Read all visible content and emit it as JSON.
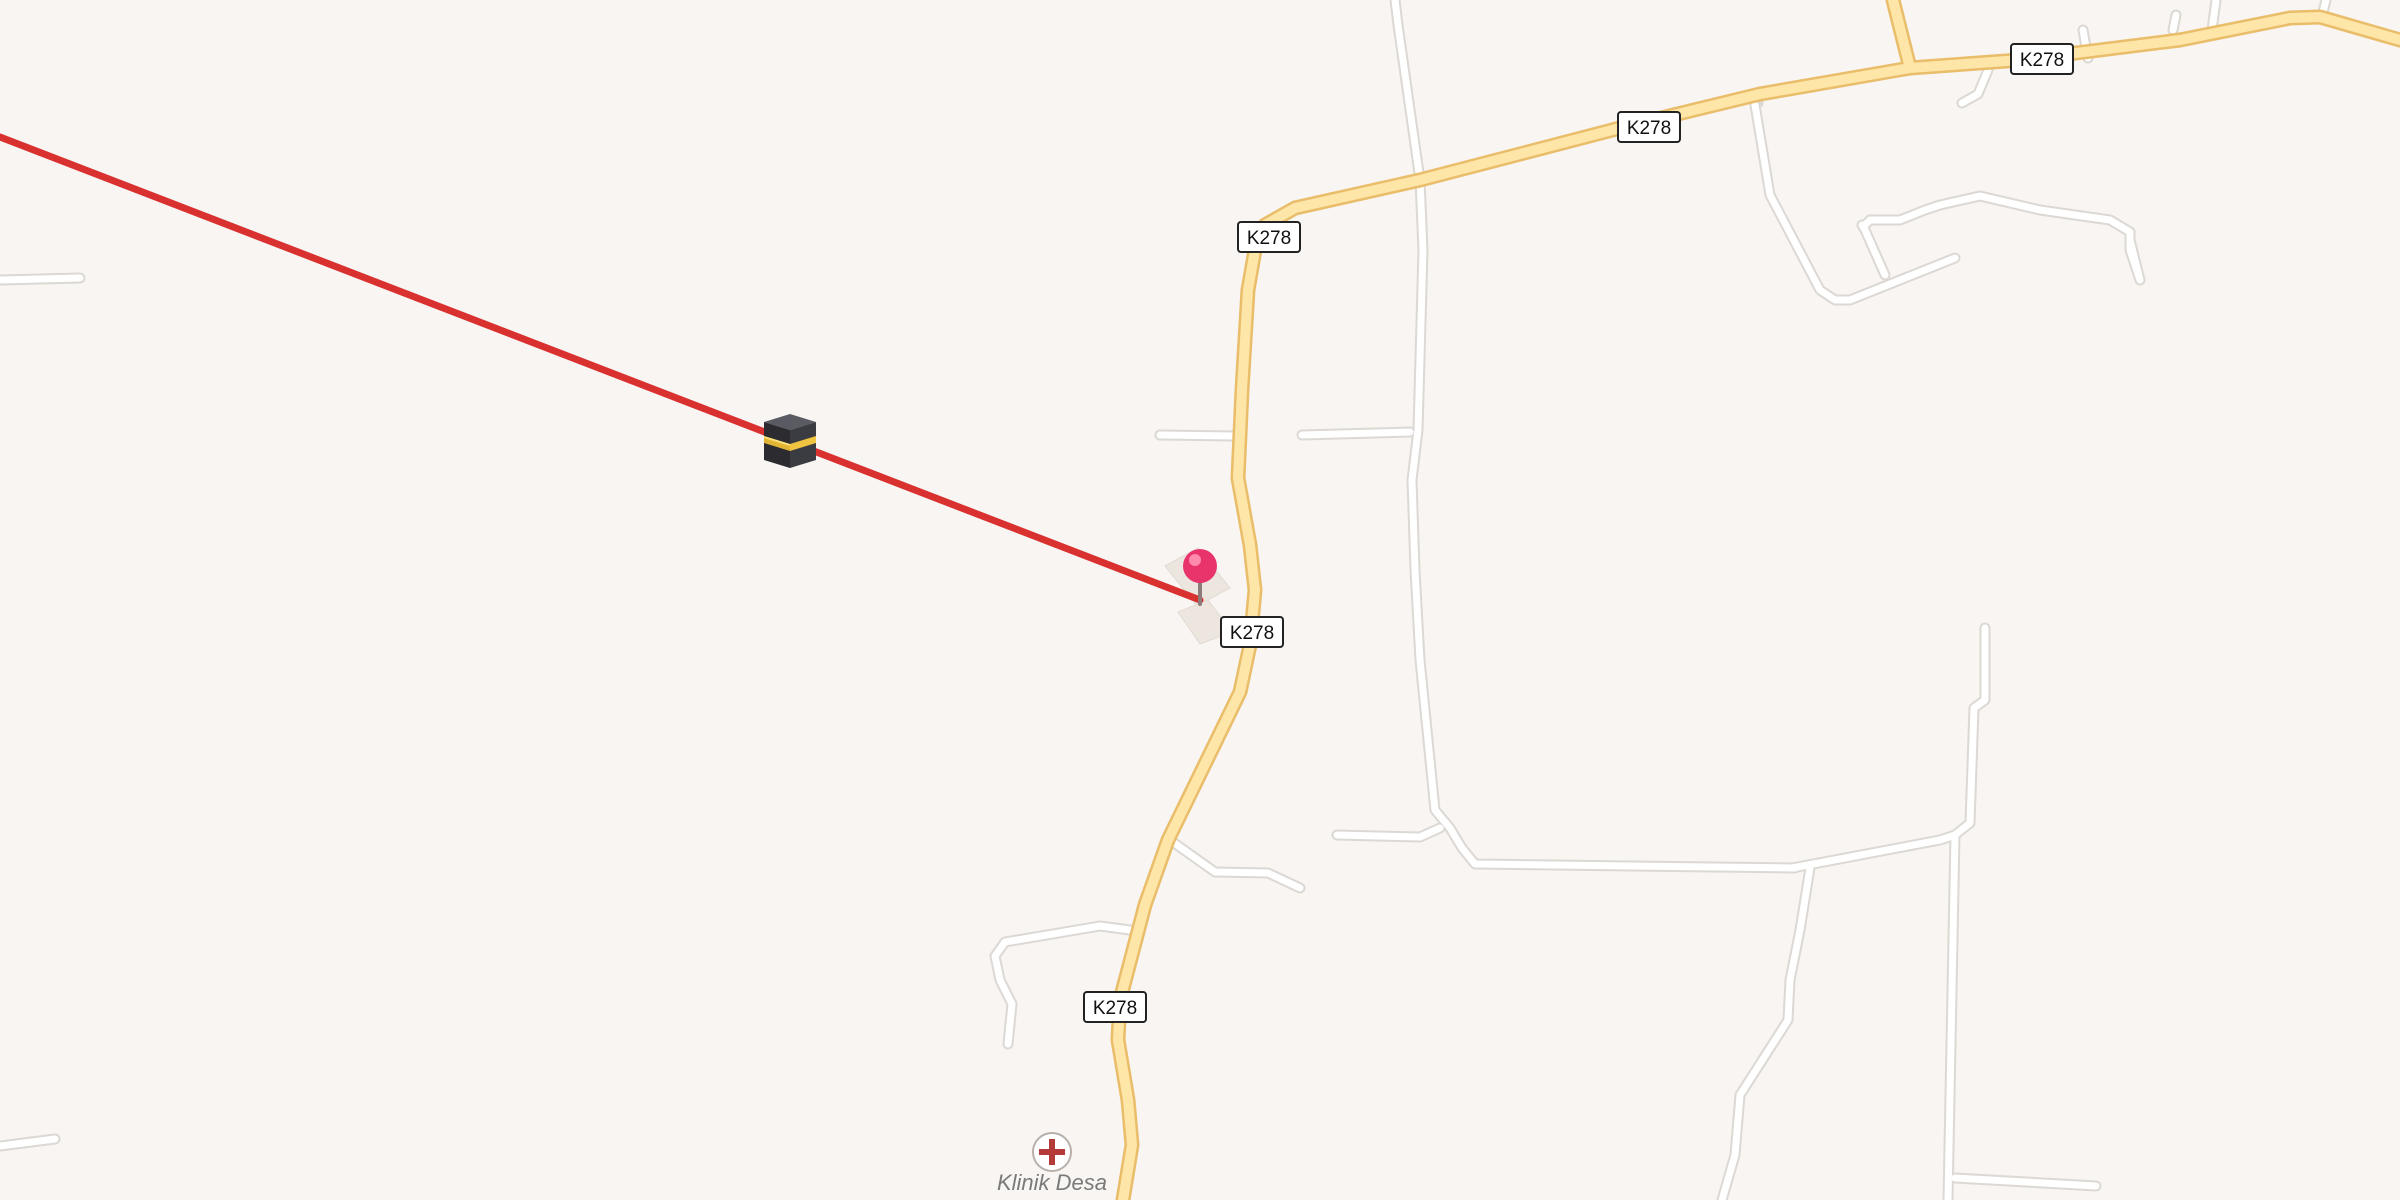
{
  "map": {
    "background_color": "#f8f5f2",
    "road_route_number": "K278",
    "qibla_line_color": "#d93030",
    "qibla_marker_icon": "kaaba-icon",
    "location_pin_icon": "map-pin-icon",
    "location_pin_color": "#e8336b",
    "poi": {
      "name": "Klinik Desa",
      "icon": "medical-cross-icon",
      "icon_color": "#b53a3a"
    }
  }
}
